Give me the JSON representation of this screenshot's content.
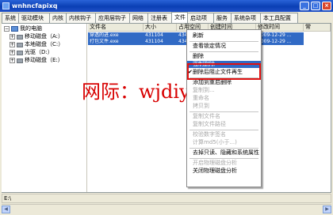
{
  "window": {
    "title": "wnhncfapixq",
    "buttons": [
      "_",
      "□",
      "×"
    ]
  },
  "tabs": [
    "系统",
    "驱动模块",
    "内核",
    "内核钩子",
    "应用层钩子",
    "网络",
    "注册表",
    "文件",
    "启动项",
    "服务",
    "系统杂项",
    "本工具配置"
  ],
  "active_tab": "文件",
  "tree": {
    "root": "我的电脑",
    "drives": [
      "移动磁盘（A:）",
      "本地磁盘（C:）",
      "光驱（D:）",
      "移动磁盘（E:）"
    ]
  },
  "file_columns": [
    "文件名",
    "大小",
    "占用空间",
    "创建时间",
    "修改时间",
    "常"
  ],
  "files": [
    [
      "穿透的进.exe",
      "431104",
      "434176",
      "2009-12-29 ...",
      "2009-12-29 ..."
    ],
    [
      "打包文件.exe",
      "431104",
      "434176",
      "2009-12-29 ...",
      "2009-12-29 ..."
    ]
  ],
  "context_menu": [
    {
      "label": "刷新",
      "enabled": true
    },
    {
      "separator": true
    },
    {
      "label": "查看锁定情况",
      "enabled": true
    },
    {
      "separator": true
    },
    {
      "label": "删除",
      "enabled": true
    },
    {
      "label": "强制删除",
      "enabled": true,
      "highlighted": true
    },
    {
      "label": "删除后阻止文件再生",
      "enabled": true,
      "checked": true
    },
    {
      "separator": true
    },
    {
      "label": "添加到重启删除",
      "enabled": true
    },
    {
      "label": "复制到...",
      "enabled": false
    },
    {
      "label": "重命名",
      "enabled": false
    },
    {
      "label": "拷贝到",
      "enabled": false
    },
    {
      "separator": true
    },
    {
      "label": "复制文件名",
      "enabled": false
    },
    {
      "label": "复制文件路径",
      "enabled": false
    },
    {
      "separator": true
    },
    {
      "label": "校验数字签名",
      "enabled": false
    },
    {
      "label": "计算md5(小于...)",
      "enabled": false
    },
    {
      "separator": true
    },
    {
      "label": "去掉只读、隐藏和系统属性",
      "enabled": true
    },
    {
      "separator": true
    },
    {
      "label": "开启物理磁盘分析",
      "enabled": false
    },
    {
      "label": "关闭物理磁盘分析",
      "enabled": true
    }
  ],
  "watermark": "网际：wjdiy.cn",
  "status_text": "E:\\",
  "colors": {
    "title_bar": "#0a3fb4",
    "selection": "#316ac5",
    "annotation_box": "#e01010",
    "watermark": "#d80000"
  }
}
